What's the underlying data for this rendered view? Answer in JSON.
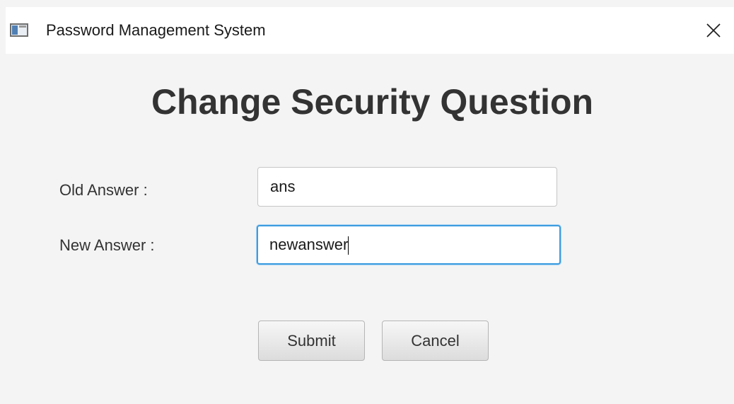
{
  "window": {
    "title": "Password Management System",
    "close_glyph": "✕",
    "icon": "app-window-icon"
  },
  "form": {
    "heading": "Change Security Question",
    "old_answer": {
      "label": "Old Answer :",
      "value": "ans"
    },
    "new_answer": {
      "label": "New Answer :",
      "value": "newanswer"
    }
  },
  "buttons": {
    "submit_label": "Submit",
    "cancel_label": "Cancel"
  },
  "colors": {
    "focus_border": "#3d9ce0",
    "background": "#f4f4f4",
    "heading_text": "#333333"
  }
}
